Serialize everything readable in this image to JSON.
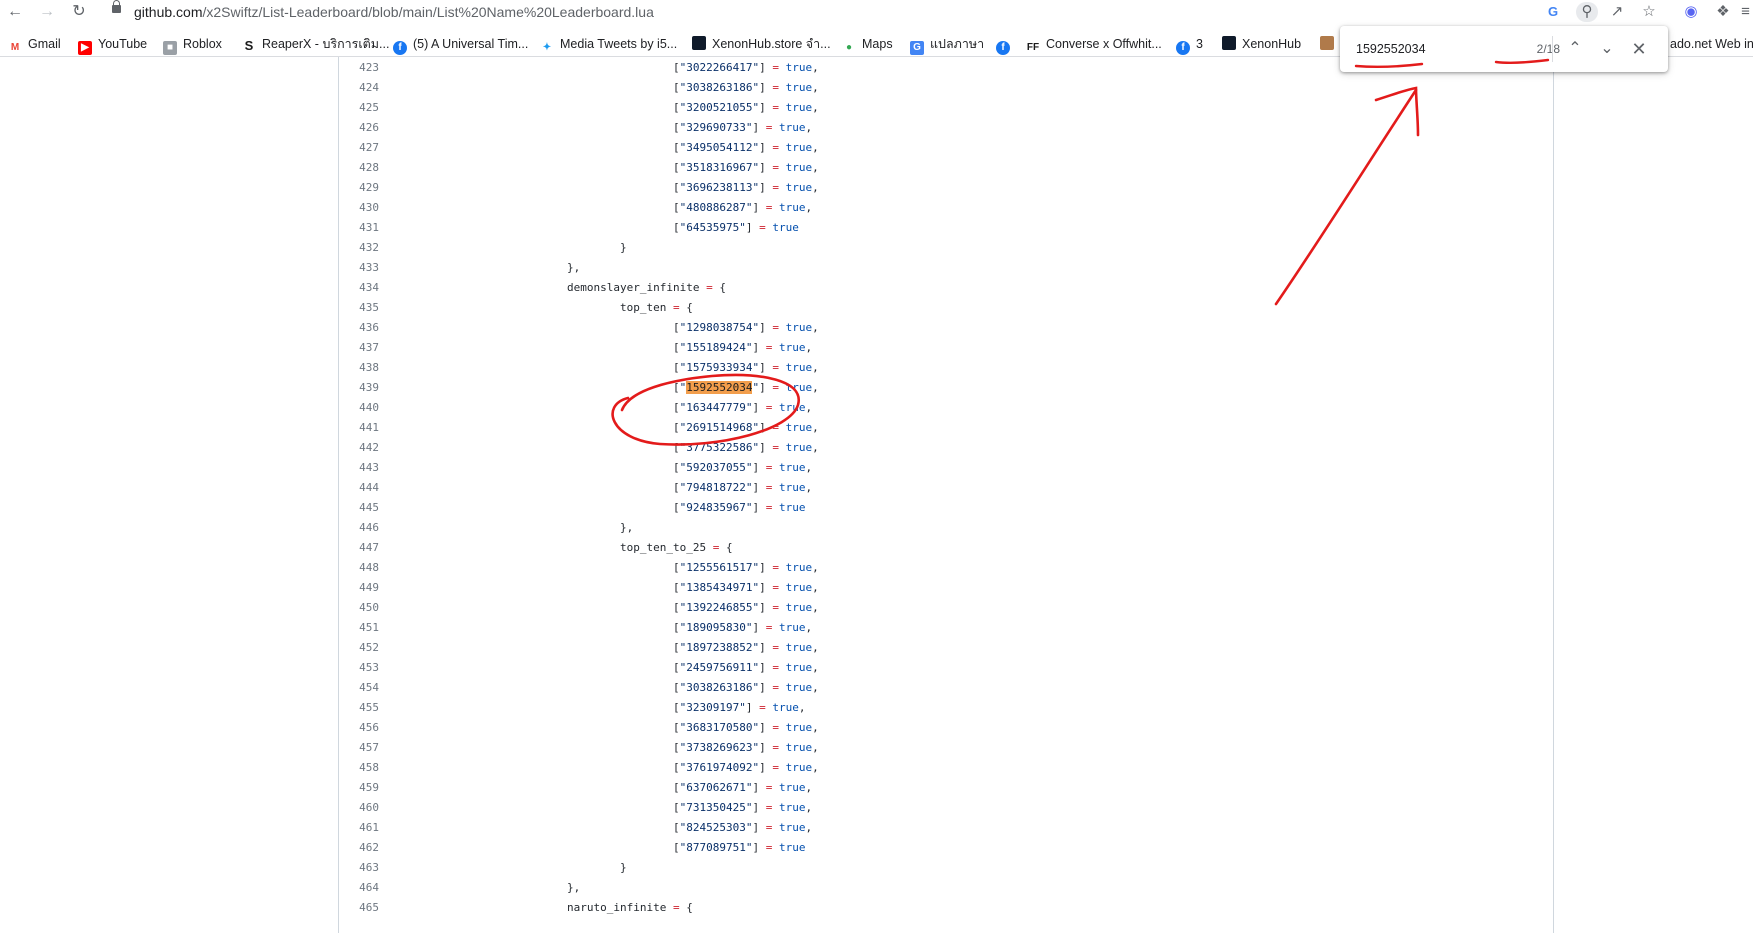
{
  "browser": {
    "url_host": "github.com",
    "url_path": "/x2Swiftz/List-Leaderboard/blob/main/List%20Name%20Leaderboard.lua"
  },
  "bookmarks": [
    {
      "label": "Gmail",
      "icon": "gmail-icon",
      "color": "#ea4335"
    },
    {
      "label": "YouTube",
      "icon": "youtube-icon",
      "color": "#ff0000"
    },
    {
      "label": "Roblox",
      "icon": "roblox-icon",
      "color": "#7a7a7a"
    },
    {
      "label": "ReaperX - บริการเติม...",
      "icon": "reaperx-icon",
      "color": "#1a1a1a"
    },
    {
      "label": "(5) A Universal Tim...",
      "icon": "facebook-icon",
      "color": "#1877f2"
    },
    {
      "label": "Media Tweets by i5...",
      "icon": "twitter-icon",
      "color": "#1d9bf0"
    },
    {
      "label": "XenonHub.store จำ...",
      "icon": "xenonhub-icon",
      "color": "#0f1a2a"
    },
    {
      "label": "Maps",
      "icon": "maps-icon",
      "color": "#34a853"
    },
    {
      "label": "แปลภาษา",
      "icon": "translate-icon",
      "color": "#4285f4"
    },
    {
      "label": "",
      "icon": "facebook-icon",
      "color": "#1877f2"
    },
    {
      "label": "Converse x Offwhit...",
      "icon": "converse-icon",
      "color": "#1a1a1a"
    },
    {
      "label": "3",
      "icon": "facebook-icon",
      "color": "#1877f2"
    },
    {
      "label": "XenonHub",
      "icon": "xenonhub-icon",
      "color": "#0f1a2a"
    },
    {
      "label": "",
      "icon": "bookmark-icon",
      "color": "#b07a4a"
    },
    {
      "label": "ado.net Web int...",
      "icon": "",
      "color": ""
    }
  ],
  "find": {
    "query": "1592552034",
    "count": "2/18"
  },
  "code_lines": [
    {
      "n": "423",
      "indent": 3,
      "key": "3022266417",
      "val": "true",
      "comma": true
    },
    {
      "n": "424",
      "indent": 3,
      "key": "3038263186",
      "val": "true",
      "comma": true
    },
    {
      "n": "425",
      "indent": 3,
      "key": "3200521055",
      "val": "true",
      "comma": true
    },
    {
      "n": "426",
      "indent": 3,
      "key": "329690733",
      "val": "true",
      "comma": true
    },
    {
      "n": "427",
      "indent": 3,
      "key": "3495054112",
      "val": "true",
      "comma": true
    },
    {
      "n": "428",
      "indent": 3,
      "key": "3518316967",
      "val": "true",
      "comma": true
    },
    {
      "n": "429",
      "indent": 3,
      "key": "3696238113",
      "val": "true",
      "comma": true
    },
    {
      "n": "430",
      "indent": 3,
      "key": "480886287",
      "val": "true",
      "comma": true
    },
    {
      "n": "431",
      "indent": 3,
      "key": "64535975",
      "val": "true",
      "comma": false
    },
    {
      "n": "432",
      "indent": 2,
      "text": "}"
    },
    {
      "n": "433",
      "indent": 1,
      "text": "},"
    },
    {
      "n": "434",
      "indent": 1,
      "name": "demonslayer_infinite"
    },
    {
      "n": "435",
      "indent": 2,
      "name": "top_ten"
    },
    {
      "n": "436",
      "indent": 3,
      "key": "1298038754",
      "val": "true",
      "comma": true
    },
    {
      "n": "437",
      "indent": 3,
      "key": "155189424",
      "val": "true",
      "comma": true
    },
    {
      "n": "438",
      "indent": 3,
      "key": "1575933934",
      "val": "true",
      "comma": true
    },
    {
      "n": "439",
      "indent": 3,
      "key": "1592552034",
      "val": "true",
      "comma": true,
      "match": true
    },
    {
      "n": "440",
      "indent": 3,
      "key": "163447779",
      "val": "true",
      "comma": true
    },
    {
      "n": "441",
      "indent": 3,
      "key": "2691514968",
      "val": "true",
      "comma": true
    },
    {
      "n": "442",
      "indent": 3,
      "key": "3775322586",
      "val": "true",
      "comma": true
    },
    {
      "n": "443",
      "indent": 3,
      "key": "592037055",
      "val": "true",
      "comma": true
    },
    {
      "n": "444",
      "indent": 3,
      "key": "794818722",
      "val": "true",
      "comma": true
    },
    {
      "n": "445",
      "indent": 3,
      "key": "924835967",
      "val": "true",
      "comma": false
    },
    {
      "n": "446",
      "indent": 2,
      "text": "},"
    },
    {
      "n": "447",
      "indent": 2,
      "name": "top_ten_to_25"
    },
    {
      "n": "448",
      "indent": 3,
      "key": "1255561517",
      "val": "true",
      "comma": true
    },
    {
      "n": "449",
      "indent": 3,
      "key": "1385434971",
      "val": "true",
      "comma": true
    },
    {
      "n": "450",
      "indent": 3,
      "key": "1392246855",
      "val": "true",
      "comma": true
    },
    {
      "n": "451",
      "indent": 3,
      "key": "189095830",
      "val": "true",
      "comma": true
    },
    {
      "n": "452",
      "indent": 3,
      "key": "1897238852",
      "val": "true",
      "comma": true
    },
    {
      "n": "453",
      "indent": 3,
      "key": "2459756911",
      "val": "true",
      "comma": true
    },
    {
      "n": "454",
      "indent": 3,
      "key": "3038263186",
      "val": "true",
      "comma": true
    },
    {
      "n": "455",
      "indent": 3,
      "key": "32309197",
      "val": "true",
      "comma": true
    },
    {
      "n": "456",
      "indent": 3,
      "key": "3683170580",
      "val": "true",
      "comma": true
    },
    {
      "n": "457",
      "indent": 3,
      "key": "3738269623",
      "val": "true",
      "comma": true
    },
    {
      "n": "458",
      "indent": 3,
      "key": "3761974092",
      "val": "true",
      "comma": true
    },
    {
      "n": "459",
      "indent": 3,
      "key": "637062671",
      "val": "true",
      "comma": true
    },
    {
      "n": "460",
      "indent": 3,
      "key": "731350425",
      "val": "true",
      "comma": true
    },
    {
      "n": "461",
      "indent": 3,
      "key": "824525303",
      "val": "true",
      "comma": true
    },
    {
      "n": "462",
      "indent": 3,
      "key": "877089751",
      "val": "true",
      "comma": false
    },
    {
      "n": "463",
      "indent": 2,
      "text": "}"
    },
    {
      "n": "464",
      "indent": 1,
      "text": "},"
    },
    {
      "n": "465",
      "indent": 1,
      "name": "naruto_infinite"
    }
  ],
  "colors": {
    "string": "#0a3069",
    "keyword": "#0550ae",
    "operator": "#cf222e",
    "match_highlight": "#f29e4c",
    "annotation": "#e31b1b"
  }
}
